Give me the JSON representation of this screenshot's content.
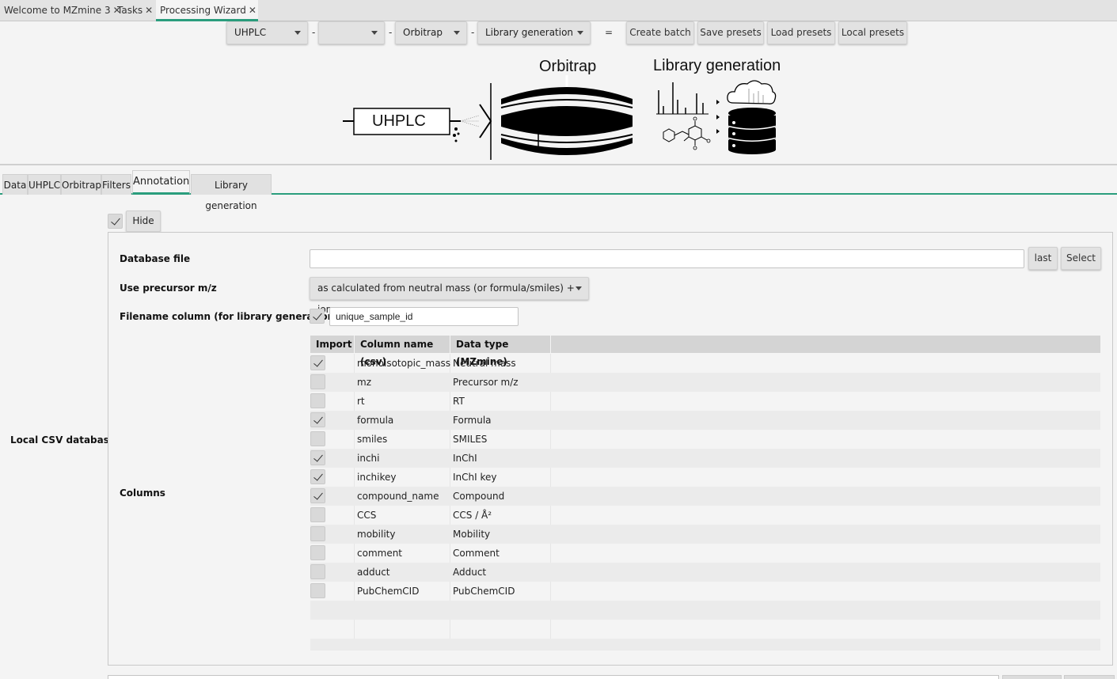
{
  "doc_tabs": [
    {
      "label": "Welcome to MZmine 3"
    },
    {
      "label": "Tasks"
    },
    {
      "label": "Processing Wizard"
    }
  ],
  "close_glyph": "✕",
  "toolbar": {
    "combo_uhplc": "UHPLC",
    "combo_empty": "",
    "combo_orbitrap": "Orbitrap",
    "combo_library": "Library generation",
    "sep": "-",
    "equals": "=",
    "create_batch": "Create batch",
    "save_presets": "Save presets",
    "load_presets": "Load presets",
    "local_presets": "Local presets"
  },
  "diagram": {
    "uhplc": "UHPLC",
    "orbitrap": "Orbitrap",
    "library": "Library generation"
  },
  "step_tabs": [
    {
      "label": "Data"
    },
    {
      "label": "UHPLC"
    },
    {
      "label": "Orbitrap"
    },
    {
      "label": "Filters"
    },
    {
      "label": "Annotation"
    },
    {
      "label": "Library generation"
    }
  ],
  "module": {
    "side_label": "Local CSV database",
    "enabled": true,
    "hide_label": "Hide"
  },
  "form": {
    "database_file_label": "Database file",
    "database_file_value": "",
    "last_button": "last",
    "select_button": "Select",
    "precursor_label": "Use precursor m/z",
    "precursor_value": "as calculated from neutral mass (or formula/smiles) + ions",
    "filename_label": "Filename column (for library generation)",
    "filename_enabled": true,
    "filename_value": "unique_sample_id",
    "columns_label": "Columns"
  },
  "table": {
    "headers": [
      "Import",
      "Column name (csv)",
      "Data type (MZmine)"
    ],
    "rows": [
      {
        "import": true,
        "name": "monoisotopic_mass",
        "type": "Neutral mass"
      },
      {
        "import": false,
        "name": "mz",
        "type": "Precursor m/z"
      },
      {
        "import": false,
        "name": "rt",
        "type": "RT"
      },
      {
        "import": true,
        "name": "formula",
        "type": "Formula"
      },
      {
        "import": false,
        "name": "smiles",
        "type": "SMILES"
      },
      {
        "import": true,
        "name": "inchi",
        "type": "InChI"
      },
      {
        "import": true,
        "name": "inchikey",
        "type": "InChI key"
      },
      {
        "import": true,
        "name": "compound_name",
        "type": "Compound"
      },
      {
        "import": false,
        "name": "CCS",
        "type": "CCS / Å²"
      },
      {
        "import": false,
        "name": "mobility",
        "type": "Mobility"
      },
      {
        "import": false,
        "name": "comment",
        "type": "Comment"
      },
      {
        "import": false,
        "name": "adduct",
        "type": "Adduct"
      },
      {
        "import": false,
        "name": "PubChemCID",
        "type": "PubChemCID"
      }
    ]
  },
  "colors": {
    "accent": "#2a9d7d",
    "background": "#f4f4f4",
    "button": "#e2e2e2"
  }
}
